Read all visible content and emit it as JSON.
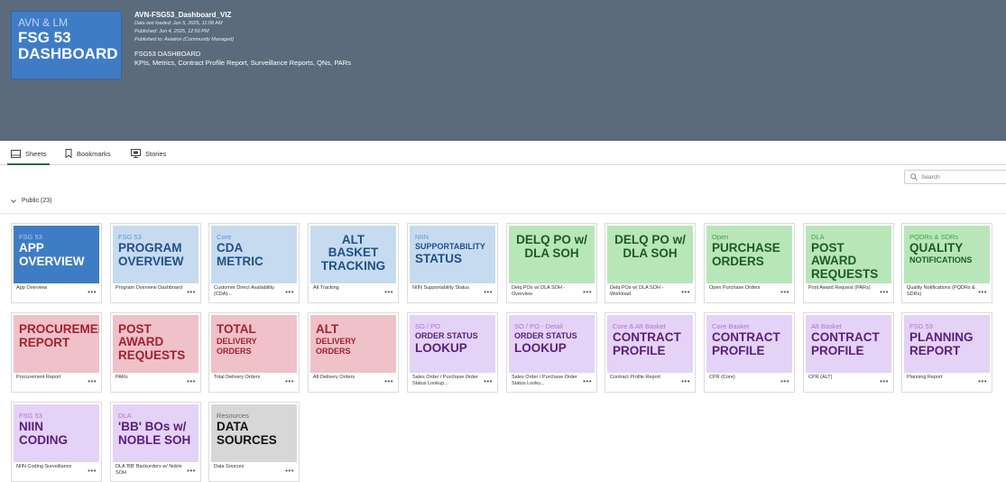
{
  "header": {
    "logo": {
      "line1": "AVN & LM",
      "line2": "FSG 53",
      "line3": "DASHBOARD"
    },
    "app_title": "AVN-FSG53_Dashboard_VIZ",
    "meta": [
      "Data last loaded: Jun 5, 2025, 11:08 AM",
      "Published: Jun 4, 2025, 12:50 PM",
      "Published to: Aviation (Community Managed)"
    ],
    "desc_title": "FSG53 DASHBOARD",
    "desc": "KPIs, Metrics, Contract Profile Report, Surveillance Reports, QNs, PARs"
  },
  "tabs": [
    {
      "label": "Sheets",
      "icon": "sheets-icon",
      "active": true
    },
    {
      "label": "Bookmarks",
      "icon": "bookmark-icon",
      "active": false
    },
    {
      "label": "Stories",
      "icon": "stories-icon",
      "active": false
    }
  ],
  "search": {
    "placeholder": "Search"
  },
  "section": {
    "label": "Public (23)"
  },
  "cards": [
    {
      "theme": "blue",
      "small": "FSG 53",
      "big": [
        "APP",
        "OVERVIEW"
      ],
      "caption": "App Overview"
    },
    {
      "theme": "lblue",
      "small": "FSG 53",
      "big": [
        "PROGRAM",
        "OVERVIEW"
      ],
      "caption": "Program Overview Dashboard"
    },
    {
      "theme": "lblue",
      "small": "Core",
      "big": [
        "CDA",
        "METRIC"
      ],
      "caption": "Customer Direct Availability (CDA)..."
    },
    {
      "theme": "lblue",
      "small": "",
      "big": [
        "ALT BASKET",
        "TRACKING"
      ],
      "center": true,
      "caption": "Alt Tracking"
    },
    {
      "theme": "lblue",
      "small": "NIIN",
      "big2": "SUPPORTABILITY",
      "big": [
        "STATUS"
      ],
      "caption": "NIIN Supportability Status"
    },
    {
      "theme": "green",
      "small": "",
      "big": [
        "DELQ PO w/",
        "DLA SOH"
      ],
      "center": true,
      "caption": "Delq POs w/ DLA SOH - Overview"
    },
    {
      "theme": "green",
      "small": "",
      "big": [
        "DELQ PO w/",
        "DLA SOH"
      ],
      "center": true,
      "caption": "Delq POs w/ DLA SOH - Workload"
    },
    {
      "theme": "green",
      "small": "Open",
      "big": [
        "PURCHASE",
        "ORDERS"
      ],
      "caption": "Open Purchase Orders"
    },
    {
      "theme": "green",
      "small": "DLA",
      "big": [
        "POST AWARD",
        "REQUESTS"
      ],
      "caption": "Post Award Request (PARs)"
    },
    {
      "theme": "green",
      "small": "PQDRs & SDRs",
      "big": [
        "QUALITY"
      ],
      "big2": "NOTIFICATIONS",
      "big2After": true,
      "caption": "Quality Notifications (PQDRs & SDRs)"
    },
    {
      "theme": "pink",
      "small": "",
      "big": [
        "PROCUREMENT",
        "REPORT"
      ],
      "caption": "Procurement Report"
    },
    {
      "theme": "pink",
      "small": "",
      "big": [
        "POST AWARD",
        "REQUESTS"
      ],
      "caption": "PARs"
    },
    {
      "theme": "pink",
      "small": "",
      "big": [
        "TOTAL"
      ],
      "big2": "DELIVERY ORDERS",
      "big2After": true,
      "caption": "Total Delivery Orders"
    },
    {
      "theme": "pink",
      "small": "",
      "big": [
        "ALT"
      ],
      "big2": "DELIVERY ORDERS",
      "big2After": true,
      "caption": "Alt Delivery Orders"
    },
    {
      "theme": "purple",
      "small": "SO / PO",
      "big2": "ORDER STATUS",
      "big": [
        "LOOKUP"
      ],
      "caption": "Sales Order / Purchase Order Status Lookup..."
    },
    {
      "theme": "purple",
      "small": "SO / PO - Detail",
      "big2": "ORDER STATUS",
      "big": [
        "LOOKUP"
      ],
      "caption": "Sales Order / Purchase Order Status Looku..."
    },
    {
      "theme": "purple",
      "small": "Core & Alt Basket",
      "big": [
        "CONTRACT",
        "PROFILE"
      ],
      "caption": "Contract Profile Report"
    },
    {
      "theme": "purple",
      "small": "Core Basket",
      "big": [
        "CONTRACT",
        "PROFILE"
      ],
      "caption": "CPR (Core)"
    },
    {
      "theme": "purple",
      "small": "Alt Basket",
      "big": [
        "CONTRACT",
        "PROFILE"
      ],
      "caption": "CPR (ALT)"
    },
    {
      "theme": "purple",
      "small": "FSG 53",
      "big": [
        "PLANNING",
        "REPORT"
      ],
      "caption": "Planning Report"
    },
    {
      "theme": "purple",
      "small": "FSG 53",
      "big": [
        "NIIN",
        "CODING"
      ],
      "caption": "NIIN Coding Surveillance"
    },
    {
      "theme": "purple",
      "small": "DLA",
      "big": [
        "'BB' BOs w/",
        "NOBLE SOH"
      ],
      "caption": "DLA 'BB' Backorders w/ Noble SOH"
    },
    {
      "theme": "gray",
      "small": "Resources",
      "big": [
        "DATA",
        "SOURCES"
      ],
      "caption": "Data Sources"
    }
  ],
  "more_label": "•••"
}
